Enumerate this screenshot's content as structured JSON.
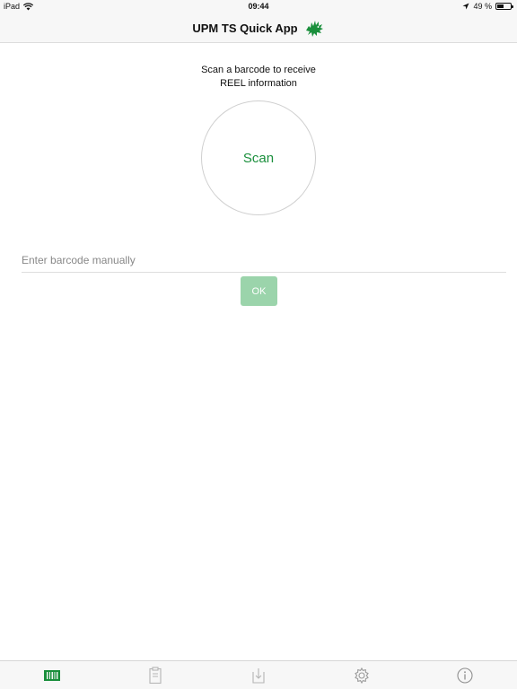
{
  "status_bar": {
    "device": "iPad",
    "time": "09:44",
    "battery_text": "49 %",
    "battery_level": 0.49
  },
  "nav": {
    "title": "UPM TS Quick App",
    "logo_icon": "griffin-logo-icon"
  },
  "main": {
    "prompt_line1": "Scan a barcode to receive",
    "prompt_line2": "REEL information",
    "scan_label": "Scan",
    "barcode_placeholder": "Enter barcode manually",
    "barcode_value": "",
    "ok_label": "OK"
  },
  "tab_bar": {
    "items": [
      {
        "icon": "barcode-scan-icon",
        "active": true
      },
      {
        "icon": "clipboard-icon",
        "active": false
      },
      {
        "icon": "download-icon",
        "active": false
      },
      {
        "icon": "gear-icon",
        "active": false
      },
      {
        "icon": "info-icon",
        "active": false
      }
    ]
  },
  "colors": {
    "accent": "#1a8f3c",
    "ok_button": "#9bd4ab",
    "inactive_icon": "#b5b5b5",
    "bar_background": "#f7f7f7"
  }
}
